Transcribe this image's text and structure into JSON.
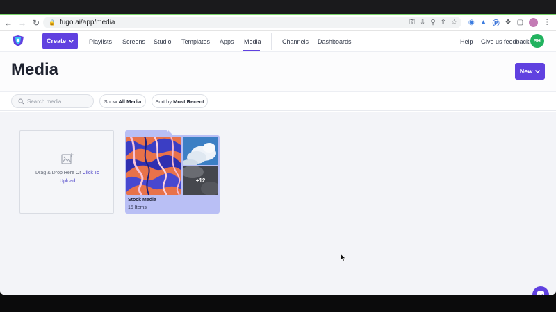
{
  "browser": {
    "url": "fugo.ai/app/media"
  },
  "header": {
    "create_label": "Create",
    "nav": [
      "Playlists",
      "Screens",
      "Studio",
      "Templates",
      "Apps",
      "Media",
      "Channels",
      "Dashboards"
    ],
    "active_nav": "Media",
    "help_label": "Help",
    "feedback_label": "Give us feedback",
    "avatar_initials": "SH"
  },
  "page": {
    "title": "Media",
    "new_label": "New"
  },
  "filters": {
    "search_placeholder": "Search media",
    "show_prefix": "Show",
    "show_value": "All Media",
    "sort_prefix": "Sort by",
    "sort_value": "Most Recent"
  },
  "upload": {
    "text": "Drag & Drop Here Or",
    "link_line1": "Click To",
    "link_line2": "Upload"
  },
  "folders": [
    {
      "name": "Stock Media",
      "count": "15 Items",
      "more": "+12"
    }
  ],
  "colors": {
    "accent": "#6041e0",
    "avatar": "#22b35f",
    "folder": "#b9bff5"
  },
  "icons": {
    "upload": "image-plus-icon",
    "search": "search-icon",
    "chat": "chat-icon"
  }
}
